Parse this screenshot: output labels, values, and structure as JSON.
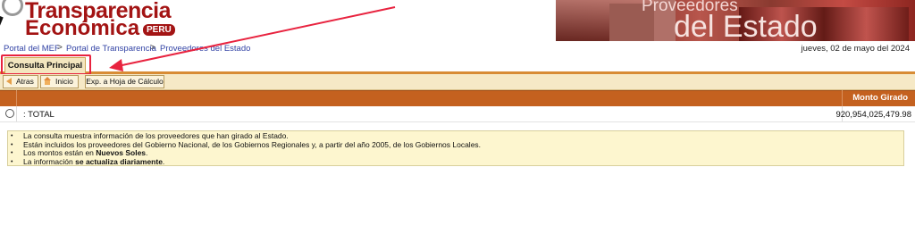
{
  "logo": {
    "line1": "Transparencia",
    "line2": "Económica",
    "badge": "PERU"
  },
  "banner": {
    "line1": "Proveedores",
    "line2": "del Estado"
  },
  "breadcrumb": {
    "items": [
      "Portal del MEF",
      "Portal de Transparencia",
      "Proveedores del Estado"
    ],
    "separator": ">"
  },
  "date": "jueves, 02 de mayo del 2024",
  "tabs": [
    {
      "label": "Consulta Principal",
      "active": true
    }
  ],
  "toolbar": {
    "back_label": "Atras",
    "home_label": "Inicio",
    "export_label": "Exp. a Hoja de Cálculo"
  },
  "table": {
    "columns": [
      "",
      "",
      "Monto Girado"
    ],
    "rows": [
      {
        "label": ": TOTAL",
        "monto": "920,954,025,479.98"
      }
    ]
  },
  "notes": [
    "La consulta muestra información de los proveedores que han girado al Estado.",
    "Están incluidos los proveedores del Gobierno Nacional, de los Gobiernos Regionales y, a partir del año 2005, de los Gobiernos Locales.",
    {
      "pre": "Los montos están en ",
      "bold": "Nuevos Soles",
      "post": "."
    },
    {
      "pre": "La información ",
      "bold": "se actualiza diariamente",
      "post": "."
    }
  ],
  "colors": {
    "brand_red": "#a31414",
    "header_orange": "#c4611f",
    "toolbar_bg": "#f6e9c6",
    "annotation_red": "#e8233f"
  },
  "icons": [
    "magnifier-logo-icon",
    "back-arrow-icon",
    "home-icon",
    "annotation-arrow-icon"
  ]
}
